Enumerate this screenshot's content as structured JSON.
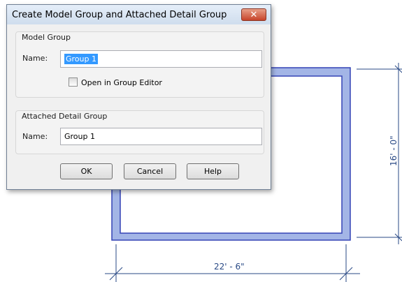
{
  "drawing": {
    "vertical_dimension": "16' - 0\"",
    "horizontal_dimension": "22' - 6\""
  },
  "dialog": {
    "title": "Create Model Group and Attached Detail Group",
    "close_icon": "close-x-icon",
    "close_color": "#c7442a",
    "model_group": {
      "heading": "Model Group",
      "name_label": "Name:",
      "name_value": "Group 1",
      "open_in_editor_label": "Open in Group Editor",
      "open_in_editor_checked": false
    },
    "detail_group": {
      "heading": "Attached Detail Group",
      "name_label": "Name:",
      "name_value": "Group 1"
    },
    "buttons": {
      "ok": "OK",
      "cancel": "Cancel",
      "help": "Help"
    }
  },
  "colors": {
    "wall_fill": "#a3b5e6",
    "wall_outline": "#3443b6",
    "dimension": "#2a4a86"
  }
}
